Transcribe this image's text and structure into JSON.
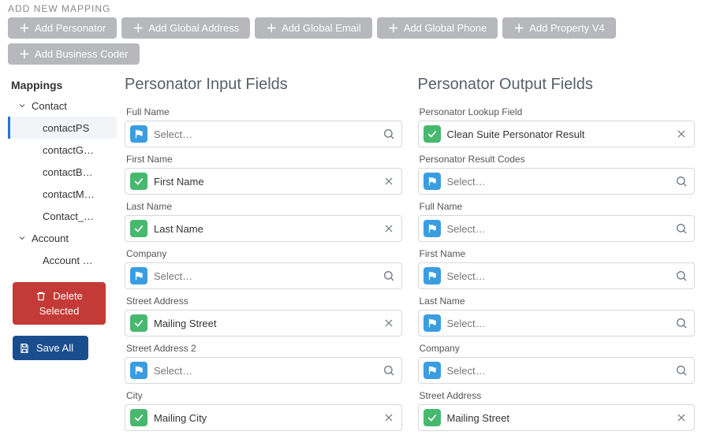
{
  "header": {
    "label": "ADD NEW MAPPING"
  },
  "add_buttons": {
    "personator": "Add Personator",
    "global_address": "Add Global Address",
    "global_email": "Add Global Email",
    "global_phone": "Add Global Phone",
    "property_v4": "Add Property V4",
    "business_coder": "Add Business Coder"
  },
  "sidebar": {
    "title": "Mappings",
    "groups": [
      {
        "label": "Contact",
        "items": [
          {
            "label": "contactPS",
            "active": true
          },
          {
            "label": "contactG…"
          },
          {
            "label": "contactB…"
          },
          {
            "label": "contactM…"
          },
          {
            "label": "Contact_…"
          }
        ]
      },
      {
        "label": "Account",
        "items": [
          {
            "label": "Account …"
          }
        ]
      }
    ],
    "delete_line1": "Delete",
    "delete_line2": "Selected",
    "save_all": "Save All"
  },
  "input_col": {
    "title": "Personator Input Fields",
    "fields": [
      {
        "label": "Full Name",
        "badge": "blue",
        "value": "Select…",
        "placeholder": true,
        "end": "search"
      },
      {
        "label": "First Name",
        "badge": "green",
        "value": "First Name",
        "placeholder": false,
        "end": "clear"
      },
      {
        "label": "Last Name",
        "badge": "green",
        "value": "Last Name",
        "placeholder": false,
        "end": "clear"
      },
      {
        "label": "Company",
        "badge": "blue",
        "value": "Select…",
        "placeholder": true,
        "end": "search"
      },
      {
        "label": "Street Address",
        "badge": "green",
        "value": "Mailing Street",
        "placeholder": false,
        "end": "clear"
      },
      {
        "label": "Street Address 2",
        "badge": "blue",
        "value": "Select…",
        "placeholder": true,
        "end": "search"
      },
      {
        "label": "City",
        "badge": "green",
        "value": "Mailing City",
        "placeholder": false,
        "end": "clear"
      }
    ]
  },
  "output_col": {
    "title": "Personator Output Fields",
    "fields": [
      {
        "label": "Personator Lookup Field",
        "badge": "green",
        "value": "Clean Suite Personator Result",
        "placeholder": false,
        "end": "clear"
      },
      {
        "label": "Personator Result Codes",
        "badge": "blue",
        "value": "Select…",
        "placeholder": true,
        "end": "search"
      },
      {
        "label": "Full Name",
        "badge": "blue",
        "value": "Select…",
        "placeholder": true,
        "end": "search"
      },
      {
        "label": "First Name",
        "badge": "blue",
        "value": "Select…",
        "placeholder": true,
        "end": "search"
      },
      {
        "label": "Last Name",
        "badge": "blue",
        "value": "Select…",
        "placeholder": true,
        "end": "search"
      },
      {
        "label": "Company",
        "badge": "blue",
        "value": "Select…",
        "placeholder": true,
        "end": "search"
      },
      {
        "label": "Street Address",
        "badge": "green",
        "value": "Mailing Street",
        "placeholder": false,
        "end": "clear"
      }
    ]
  }
}
